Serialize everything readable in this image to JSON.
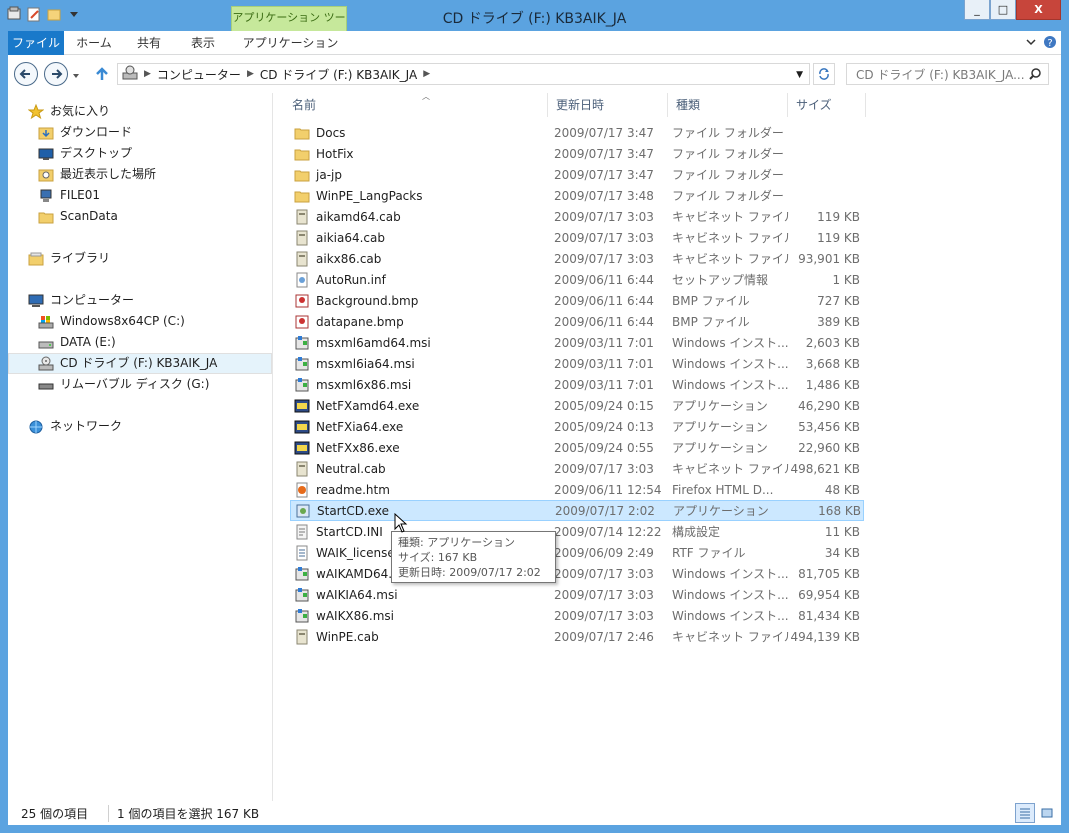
{
  "window": {
    "title": "CD ドライブ (F:) KB3AIK_JA",
    "context_tab": "アプリケーション ツール",
    "controls": [
      "_",
      "□",
      "X"
    ]
  },
  "ribbon": {
    "tabs": [
      "ファイル",
      "ホーム",
      "共有",
      "表示",
      "アプリケーション"
    ]
  },
  "address": {
    "crumbs": [
      "コンピューター",
      "CD ドライブ (F:) KB3AIK_JA"
    ]
  },
  "search": {
    "placeholder": "CD ドライブ (F:) KB3AIK_JA..."
  },
  "nav": {
    "favorites": "お気に入り",
    "fav_items": [
      "ダウンロード",
      "デスクトップ",
      "最近表示した場所",
      "FILE01",
      "ScanData"
    ],
    "libraries": "ライブラリ",
    "computer": "コンピューター",
    "drives": [
      "Windows8x64CP (C:)",
      "DATA (E:)",
      "CD ドライブ (F:) KB3AIK_JA",
      "リムーバブル ディスク (G:)"
    ],
    "network": "ネットワーク"
  },
  "columns": {
    "name": "名前",
    "date": "更新日時",
    "type": "種類",
    "size": "サイズ"
  },
  "files": [
    {
      "name": "Docs",
      "date": "2009/07/17 3:47",
      "type": "ファイル フォルダー",
      "size": "",
      "icon": "folder"
    },
    {
      "name": "HotFix",
      "date": "2009/07/17 3:47",
      "type": "ファイル フォルダー",
      "size": "",
      "icon": "folder"
    },
    {
      "name": "ja-jp",
      "date": "2009/07/17 3:47",
      "type": "ファイル フォルダー",
      "size": "",
      "icon": "folder"
    },
    {
      "name": "WinPE_LangPacks",
      "date": "2009/07/17 3:48",
      "type": "ファイル フォルダー",
      "size": "",
      "icon": "folder"
    },
    {
      "name": "aikamd64.cab",
      "date": "2009/07/17 3:03",
      "type": "キャビネット ファイル",
      "size": "119 KB",
      "icon": "cab"
    },
    {
      "name": "aikia64.cab",
      "date": "2009/07/17 3:03",
      "type": "キャビネット ファイル",
      "size": "119 KB",
      "icon": "cab"
    },
    {
      "name": "aikx86.cab",
      "date": "2009/07/17 3:03",
      "type": "キャビネット ファイル",
      "size": "93,901 KB",
      "icon": "cab"
    },
    {
      "name": "AutoRun.inf",
      "date": "2009/06/11 6:44",
      "type": "セットアップ情報",
      "size": "1 KB",
      "icon": "inf"
    },
    {
      "name": "Background.bmp",
      "date": "2009/06/11 6:44",
      "type": "BMP ファイル",
      "size": "727 KB",
      "icon": "bmp"
    },
    {
      "name": "datapane.bmp",
      "date": "2009/06/11 6:44",
      "type": "BMP ファイル",
      "size": "389 KB",
      "icon": "bmp"
    },
    {
      "name": "msxml6amd64.msi",
      "date": "2009/03/11 7:01",
      "type": "Windows インスト...",
      "size": "2,603 KB",
      "icon": "msi"
    },
    {
      "name": "msxml6ia64.msi",
      "date": "2009/03/11 7:01",
      "type": "Windows インスト...",
      "size": "3,668 KB",
      "icon": "msi"
    },
    {
      "name": "msxml6x86.msi",
      "date": "2009/03/11 7:01",
      "type": "Windows インスト...",
      "size": "1,486 KB",
      "icon": "msi"
    },
    {
      "name": "NetFXamd64.exe",
      "date": "2005/09/24 0:15",
      "type": "アプリケーション",
      "size": "46,290 KB",
      "icon": "exe"
    },
    {
      "name": "NetFXia64.exe",
      "date": "2005/09/24 0:13",
      "type": "アプリケーション",
      "size": "53,456 KB",
      "icon": "exe"
    },
    {
      "name": "NetFXx86.exe",
      "date": "2005/09/24 0:55",
      "type": "アプリケーション",
      "size": "22,960 KB",
      "icon": "exe"
    },
    {
      "name": "Neutral.cab",
      "date": "2009/07/17 3:03",
      "type": "キャビネット ファイル",
      "size": "498,621 KB",
      "icon": "cab"
    },
    {
      "name": "readme.htm",
      "date": "2009/06/11 12:54",
      "type": "Firefox HTML D...",
      "size": "48 KB",
      "icon": "htm"
    },
    {
      "name": "StartCD.exe",
      "date": "2009/07/17 2:02",
      "type": "アプリケーション",
      "size": "168 KB",
      "icon": "app"
    },
    {
      "name": "StartCD.INI",
      "date": "2009/07/14 12:22",
      "type": "構成設定",
      "size": "11 KB",
      "icon": "ini"
    },
    {
      "name": "WAIK_license.rtf",
      "date": "2009/06/09 2:49",
      "type": "RTF ファイル",
      "size": "34 KB",
      "icon": "rtf"
    },
    {
      "name": "wAIKAMD64.msi",
      "date": "2009/07/17 3:03",
      "type": "Windows インスト...",
      "size": "81,705 KB",
      "icon": "msi"
    },
    {
      "name": "wAIKIA64.msi",
      "date": "2009/07/17 3:03",
      "type": "Windows インスト...",
      "size": "69,954 KB",
      "icon": "msi"
    },
    {
      "name": "wAIKX86.msi",
      "date": "2009/07/17 3:03",
      "type": "Windows インスト...",
      "size": "81,434 KB",
      "icon": "msi"
    },
    {
      "name": "WinPE.cab",
      "date": "2009/07/17 2:46",
      "type": "キャビネット ファイル",
      "size": "494,139 KB",
      "icon": "cab"
    }
  ],
  "tooltip": {
    "line1": "種類: アプリケーション",
    "line2": "サイズ: 167 KB",
    "line3": "更新日時: 2009/07/17 2:02"
  },
  "status": {
    "count": "25 個の項目",
    "selection": "1 個の項目を選択 167 KB"
  }
}
